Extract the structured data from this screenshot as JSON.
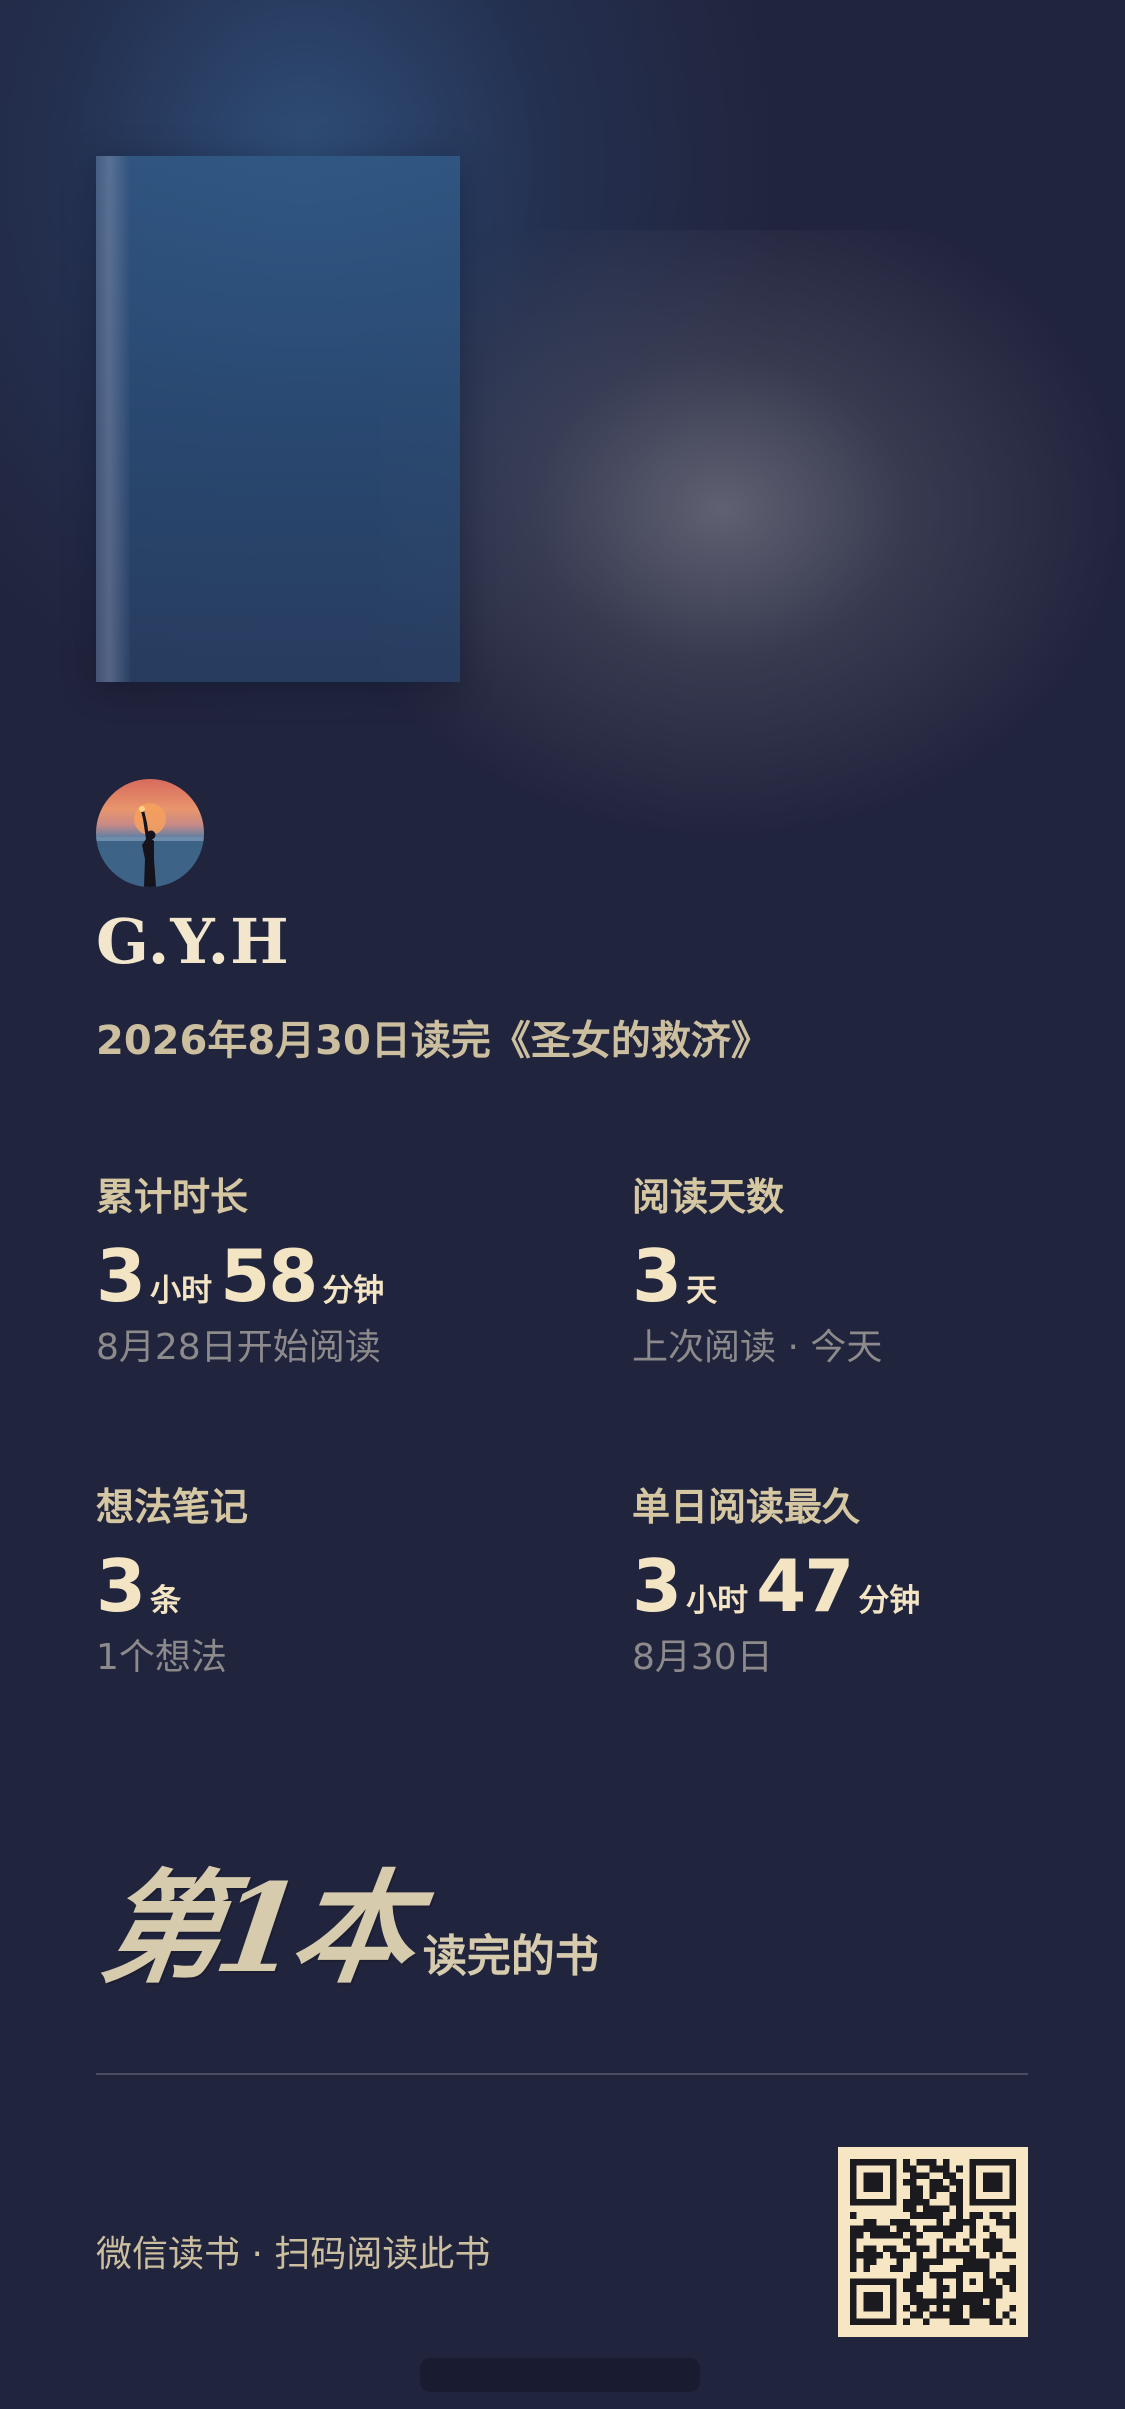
{
  "user": {
    "name": "G.Y.H"
  },
  "finish_line": "2026年8月30日读完《圣女的救济》",
  "stats": [
    {
      "label": "累计时长",
      "parts": [
        {
          "num": "3",
          "unit": "小时"
        },
        {
          "num": "58",
          "unit": "分钟"
        }
      ],
      "sub": "8月28日开始阅读"
    },
    {
      "label": "阅读天数",
      "parts": [
        {
          "num": "3",
          "unit": "天"
        }
      ],
      "sub": "上次阅读 · 今天"
    },
    {
      "label": "想法笔记",
      "parts": [
        {
          "num": "3",
          "unit": "条"
        }
      ],
      "sub": "1个想法"
    },
    {
      "label": "单日阅读最久",
      "parts": [
        {
          "num": "3",
          "unit": "小时"
        },
        {
          "num": "47",
          "unit": "分钟"
        }
      ],
      "sub": "8月30日"
    }
  ],
  "rank": {
    "ordinal_text": "第1本",
    "suffix": "读完的书"
  },
  "footer": {
    "text": "微信读书 · 扫码阅读此书"
  },
  "icons": {
    "avatar": "avatar-sunset-figure",
    "qr": "qr-code"
  },
  "colors": {
    "background": "#21243d",
    "accent_text": "#f3e4c4",
    "label_text": "#d6c7a3",
    "muted_text": "#8d8a8c"
  }
}
